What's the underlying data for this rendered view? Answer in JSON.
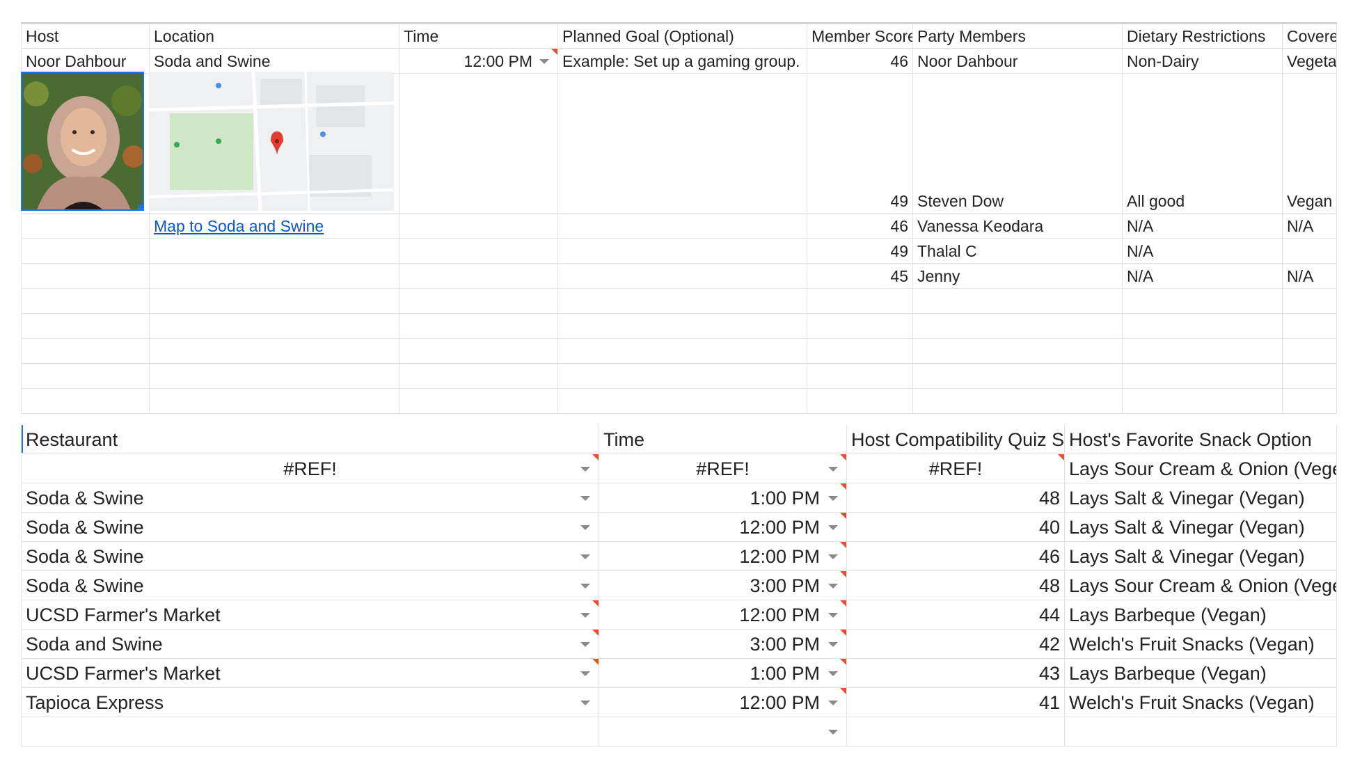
{
  "top": {
    "headers": [
      "Host",
      "Location",
      "Time",
      "Planned Goal (Optional)",
      "Member Score",
      "Party Members",
      "Dietary Restrictions",
      "Covered"
    ],
    "row1": {
      "host": "Noor Dahbour",
      "location": "Soda and Swine",
      "time": "12:00 PM",
      "goal": "Example: Set up a gaming group.",
      "score": "46",
      "member": "Noor Dahbour",
      "dietary": "Non-Dairy",
      "covered": "Vegetari"
    },
    "row2": {
      "score": "49",
      "member": "Steven Dow",
      "dietary": "All good",
      "covered": "Vegan"
    },
    "row3": {
      "map_link": "Map to Soda and Swine",
      "score": "46",
      "member": "Vanessa Keodara",
      "dietary": "N/A",
      "covered": "N/A"
    },
    "row4": {
      "score": "49",
      "member": "Thalal C",
      "dietary": "N/A",
      "covered": ""
    },
    "row5": {
      "score": "45",
      "member": "Jenny",
      "dietary": "N/A",
      "covered": "N/A"
    }
  },
  "bottom": {
    "headers": [
      "Restaurant",
      "Time",
      "Host Compatibility Quiz Score",
      "Host's Favorite Snack Option"
    ],
    "rows": [
      {
        "restaurant": "#REF!",
        "time": "#REF!",
        "score": "#REF!",
        "snack": "Lays Sour Cream & Onion (Vegetaria"
      },
      {
        "restaurant": "Soda & Swine",
        "time": "1:00 PM",
        "score": "48",
        "snack": "Lays Salt & Vinegar (Vegan)"
      },
      {
        "restaurant": "Soda & Swine",
        "time": "12:00 PM",
        "score": "40",
        "snack": "Lays Salt & Vinegar (Vegan)"
      },
      {
        "restaurant": "Soda & Swine",
        "time": "12:00 PM",
        "score": "46",
        "snack": "Lays Salt & Vinegar (Vegan)"
      },
      {
        "restaurant": "Soda & Swine",
        "time": "3:00 PM",
        "score": "48",
        "snack": "Lays Sour Cream & Onion (Vegetaria"
      },
      {
        "restaurant": "UCSD Farmer's Market",
        "time": "12:00 PM",
        "score": "44",
        "snack": "Lays Barbeque (Vegan)"
      },
      {
        "restaurant": "Soda and Swine",
        "time": "3:00 PM",
        "score": "42",
        "snack": "Welch's Fruit Snacks (Vegan)"
      },
      {
        "restaurant": "UCSD Farmer's Market",
        "time": "1:00 PM",
        "score": "43",
        "snack": "Lays Barbeque (Vegan)"
      },
      {
        "restaurant": "Tapioca Express",
        "time": "12:00 PM",
        "score": "41",
        "snack": "Welch's Fruit Snacks (Vegan)"
      }
    ]
  },
  "colors": {
    "link": "#1155cc",
    "selection": "#1a73e8",
    "note_marker": "#e8502c",
    "gridline": "#e2e3e3"
  },
  "icons": {
    "photo": "host-photo",
    "map": "map-thumbnail",
    "dropdown": "dropdown-arrow-icon",
    "note": "comment-marker"
  }
}
